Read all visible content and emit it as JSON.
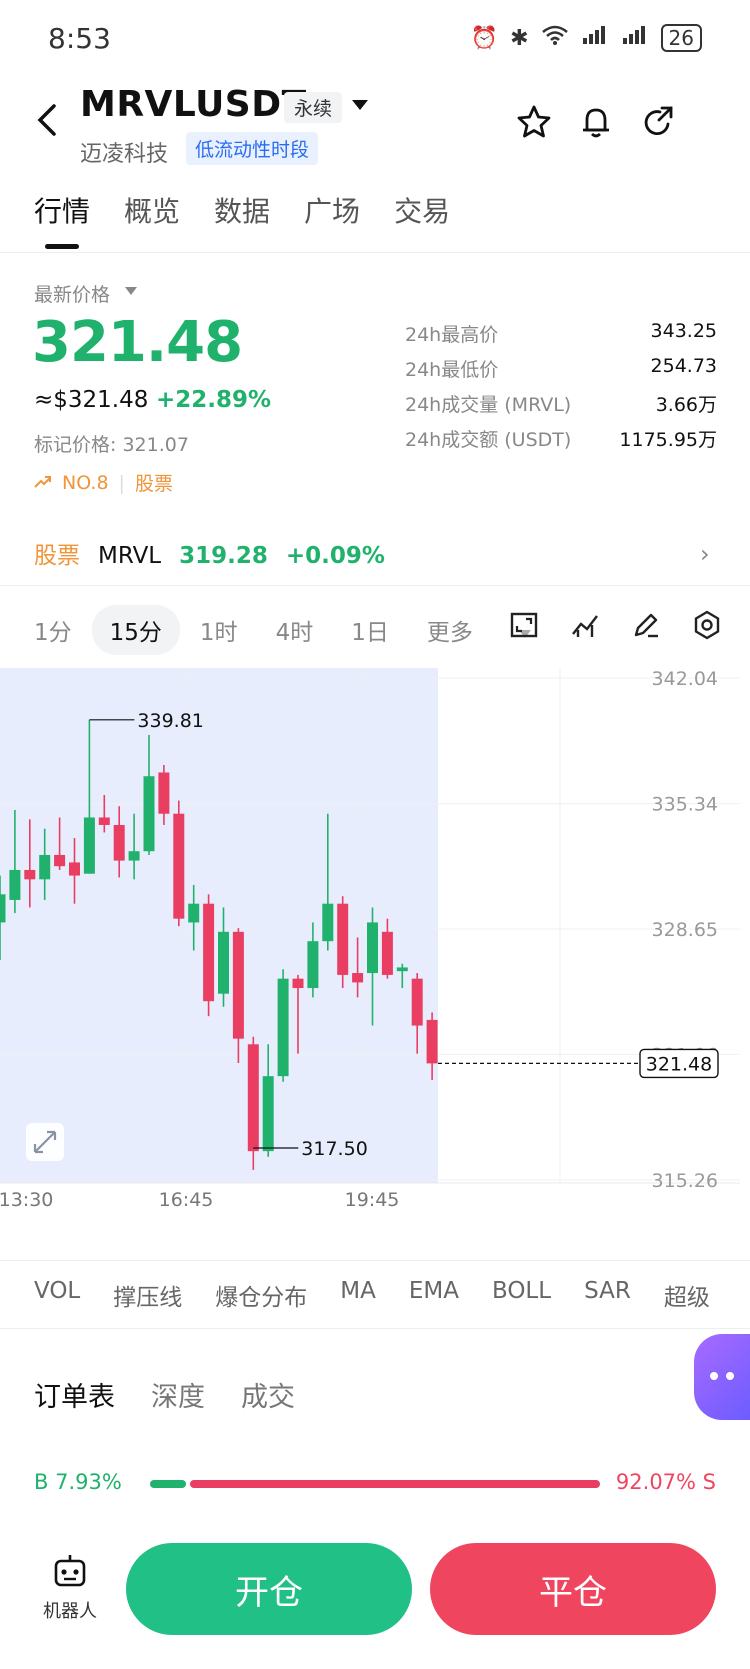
{
  "status": {
    "time": "8:53",
    "battery": "26",
    "signal_tag": "6"
  },
  "header": {
    "symbol": "MRVLUSDT",
    "contract_type": "永续",
    "name": "迈凌科技",
    "liquidity_badge": "低流动性时段"
  },
  "tabs": [
    "行情",
    "概览",
    "数据",
    "广场",
    "交易"
  ],
  "ticker": {
    "latest_label": "最新价格",
    "price": "321.48",
    "usd_price": "≈$321.48",
    "change_pct": "+22.89%",
    "mark_price": "标记价格: 321.07",
    "rank": "NO.8",
    "rank_tag": "股票"
  },
  "stats": [
    {
      "label": "24h最高价",
      "value": "343.25"
    },
    {
      "label": "24h最低价",
      "value": "254.73"
    },
    {
      "label": "24h成交量 (MRVL)",
      "value": "3.66万"
    },
    {
      "label": "24h成交额 (USDT)",
      "value": "1175.95万"
    }
  ],
  "stock_row": {
    "tag": "股票",
    "symbol": "MRVL",
    "price": "319.28",
    "change": "+0.09%"
  },
  "intervals": [
    "1分",
    "15分",
    "1时",
    "4时",
    "1日",
    "更多"
  ],
  "selected_interval": "15分",
  "chart_data": {
    "type": "candlestick",
    "price_labels": [
      "342.04",
      "335.34",
      "328.65",
      "321.96",
      "315.26"
    ],
    "time_labels": [
      "13:30",
      "16:45",
      "19:45"
    ],
    "last_price_label": "321.48",
    "high_annotation": "339.81",
    "low_annotation": "317.50",
    "ylim": [
      315.26,
      342.04
    ],
    "candles": [
      {
        "o": 329.0,
        "h": 331.5,
        "l": 327.0,
        "c": 330.5
      },
      {
        "o": 330.2,
        "h": 335.0,
        "l": 329.5,
        "c": 331.8
      },
      {
        "o": 331.8,
        "h": 334.5,
        "l": 329.8,
        "c": 331.3
      },
      {
        "o": 331.3,
        "h": 334.0,
        "l": 330.2,
        "c": 332.6
      },
      {
        "o": 332.6,
        "h": 334.6,
        "l": 331.8,
        "c": 332.0
      },
      {
        "o": 332.2,
        "h": 333.5,
        "l": 330.0,
        "c": 331.5
      },
      {
        "o": 331.6,
        "h": 339.81,
        "l": 331.6,
        "c": 334.6
      },
      {
        "o": 334.6,
        "h": 335.8,
        "l": 333.8,
        "c": 334.2
      },
      {
        "o": 334.2,
        "h": 335.2,
        "l": 331.4,
        "c": 332.3
      },
      {
        "o": 332.3,
        "h": 334.8,
        "l": 331.3,
        "c": 332.8
      },
      {
        "o": 332.8,
        "h": 339.0,
        "l": 332.6,
        "c": 336.8
      },
      {
        "o": 337.0,
        "h": 337.4,
        "l": 334.2,
        "c": 334.8
      },
      {
        "o": 334.8,
        "h": 335.5,
        "l": 328.8,
        "c": 329.2
      },
      {
        "o": 329.0,
        "h": 331.0,
        "l": 327.5,
        "c": 330.0
      },
      {
        "o": 330.0,
        "h": 330.5,
        "l": 324.0,
        "c": 324.8
      },
      {
        "o": 325.2,
        "h": 329.8,
        "l": 324.5,
        "c": 328.5
      },
      {
        "o": 328.5,
        "h": 328.7,
        "l": 321.5,
        "c": 322.8
      },
      {
        "o": 322.5,
        "h": 322.9,
        "l": 315.8,
        "c": 316.8
      },
      {
        "o": 316.8,
        "h": 322.5,
        "l": 316.5,
        "c": 320.8
      },
      {
        "o": 320.8,
        "h": 326.5,
        "l": 320.5,
        "c": 326.0
      },
      {
        "o": 326.0,
        "h": 326.2,
        "l": 322.0,
        "c": 325.5
      },
      {
        "o": 325.5,
        "h": 329.0,
        "l": 325.0,
        "c": 328.0
      },
      {
        "o": 328.0,
        "h": 334.8,
        "l": 327.5,
        "c": 330.0
      },
      {
        "o": 330.0,
        "h": 330.4,
        "l": 325.5,
        "c": 326.2
      },
      {
        "o": 326.3,
        "h": 328.2,
        "l": 325.0,
        "c": 325.8
      },
      {
        "o": 326.3,
        "h": 329.8,
        "l": 323.5,
        "c": 329.0
      },
      {
        "o": 328.5,
        "h": 329.2,
        "l": 326.0,
        "c": 326.2
      },
      {
        "o": 326.4,
        "h": 326.8,
        "l": 325.5,
        "c": 326.6
      },
      {
        "o": 326.0,
        "h": 326.3,
        "l": 322.0,
        "c": 323.5
      },
      {
        "o": 323.8,
        "h": 324.2,
        "l": 320.6,
        "c": 321.48
      }
    ],
    "grid": true
  },
  "indicators": [
    "VOL",
    "撑压线",
    "爆仓分布",
    "MA",
    "EMA",
    "BOLL",
    "SAR",
    "超级"
  ],
  "orderbook_tabs": [
    "订单表",
    "深度",
    "成交"
  ],
  "buy_sell": {
    "buy": "B 7.93%",
    "sell": "92.07% S",
    "buy_ratio": 0.0793
  },
  "bottom": {
    "robot": "机器人",
    "open": "开仓",
    "close": "平仓"
  },
  "colors": {
    "up": "#20b26c",
    "down": "#ea3d62",
    "accent": "#f0953a",
    "link": "#2a6cf0"
  }
}
